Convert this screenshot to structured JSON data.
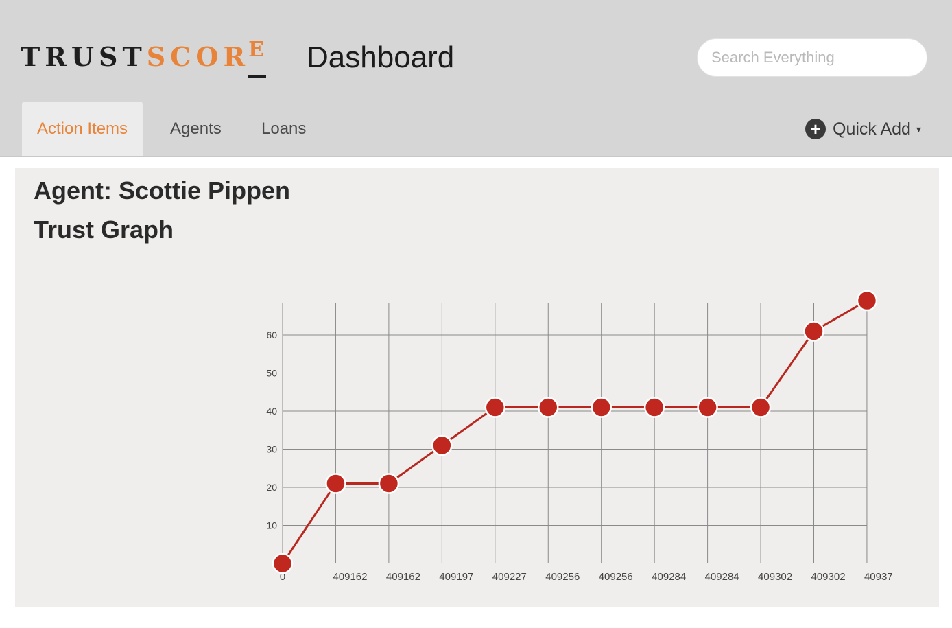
{
  "header": {
    "logo_trust": "TRUST",
    "logo_score": "SCOR",
    "logo_e": "E",
    "title": "Dashboard",
    "search_placeholder": "Search Everything"
  },
  "nav": {
    "tabs": [
      {
        "label": "Action Items",
        "active": true
      },
      {
        "label": "Agents",
        "active": false
      },
      {
        "label": "Loans",
        "active": false
      }
    ],
    "quick_add_label": "Quick Add"
  },
  "panel": {
    "agent_title": "Agent: Scottie Pippen",
    "graph_title": "Trust Graph"
  },
  "colors": {
    "accent": "#e8843a",
    "line": "#b8281f",
    "point": "#c0281f",
    "grid": "#8a8a8a"
  },
  "chart_data": {
    "type": "line",
    "title": "",
    "xlabel": "",
    "ylabel": "",
    "categories": [
      "0",
      "409162",
      "409162",
      "409197",
      "409227",
      "409256",
      "409256",
      "409284",
      "409284",
      "409302",
      "409302",
      "40937"
    ],
    "values": [
      0,
      21,
      21,
      31,
      41,
      41,
      41,
      41,
      41,
      41,
      61,
      69
    ],
    "yticks": [
      10,
      20,
      30,
      40,
      50,
      60
    ],
    "ylim": [
      0,
      69
    ],
    "grid": true,
    "legend": "none"
  }
}
